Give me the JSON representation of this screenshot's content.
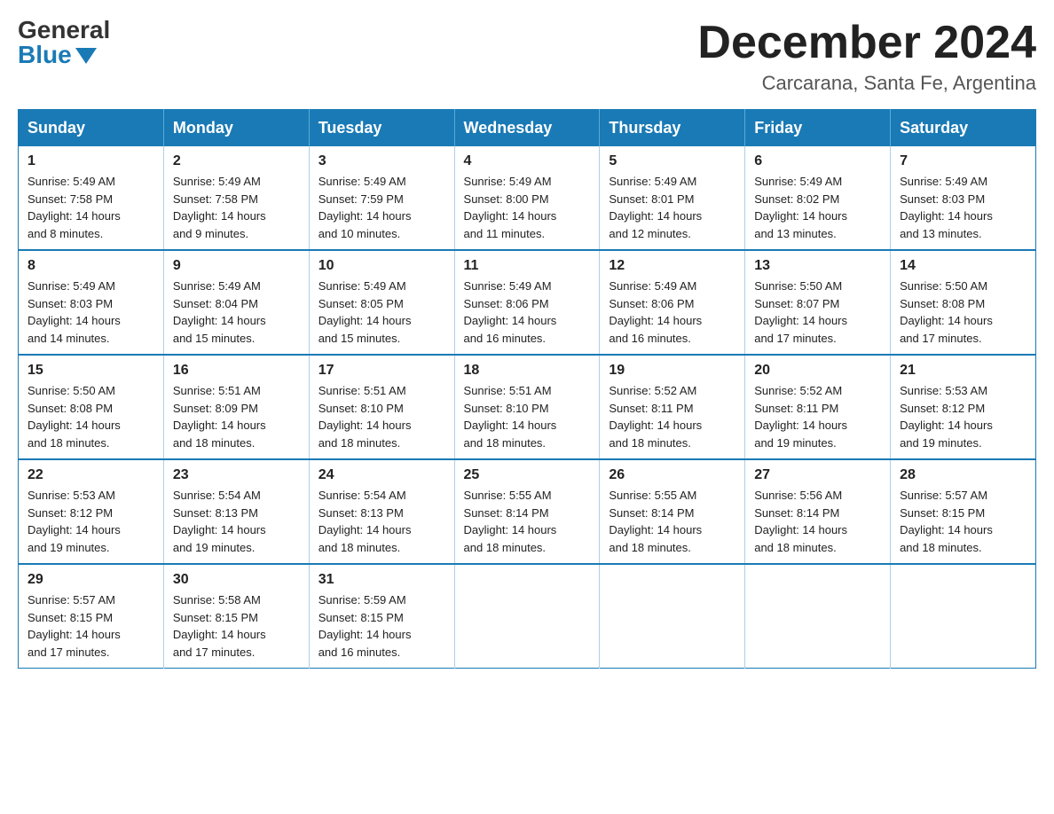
{
  "logo": {
    "general": "General",
    "blue": "Blue"
  },
  "header": {
    "month_year": "December 2024",
    "location": "Carcarana, Santa Fe, Argentina"
  },
  "weekdays": [
    "Sunday",
    "Monday",
    "Tuesday",
    "Wednesday",
    "Thursday",
    "Friday",
    "Saturday"
  ],
  "weeks": [
    [
      {
        "day": "1",
        "sunrise": "5:49 AM",
        "sunset": "7:58 PM",
        "daylight": "14 hours and 8 minutes."
      },
      {
        "day": "2",
        "sunrise": "5:49 AM",
        "sunset": "7:58 PM",
        "daylight": "14 hours and 9 minutes."
      },
      {
        "day": "3",
        "sunrise": "5:49 AM",
        "sunset": "7:59 PM",
        "daylight": "14 hours and 10 minutes."
      },
      {
        "day": "4",
        "sunrise": "5:49 AM",
        "sunset": "8:00 PM",
        "daylight": "14 hours and 11 minutes."
      },
      {
        "day": "5",
        "sunrise": "5:49 AM",
        "sunset": "8:01 PM",
        "daylight": "14 hours and 12 minutes."
      },
      {
        "day": "6",
        "sunrise": "5:49 AM",
        "sunset": "8:02 PM",
        "daylight": "14 hours and 13 minutes."
      },
      {
        "day": "7",
        "sunrise": "5:49 AM",
        "sunset": "8:03 PM",
        "daylight": "14 hours and 13 minutes."
      }
    ],
    [
      {
        "day": "8",
        "sunrise": "5:49 AM",
        "sunset": "8:03 PM",
        "daylight": "14 hours and 14 minutes."
      },
      {
        "day": "9",
        "sunrise": "5:49 AM",
        "sunset": "8:04 PM",
        "daylight": "14 hours and 15 minutes."
      },
      {
        "day": "10",
        "sunrise": "5:49 AM",
        "sunset": "8:05 PM",
        "daylight": "14 hours and 15 minutes."
      },
      {
        "day": "11",
        "sunrise": "5:49 AM",
        "sunset": "8:06 PM",
        "daylight": "14 hours and 16 minutes."
      },
      {
        "day": "12",
        "sunrise": "5:49 AM",
        "sunset": "8:06 PM",
        "daylight": "14 hours and 16 minutes."
      },
      {
        "day": "13",
        "sunrise": "5:50 AM",
        "sunset": "8:07 PM",
        "daylight": "14 hours and 17 minutes."
      },
      {
        "day": "14",
        "sunrise": "5:50 AM",
        "sunset": "8:08 PM",
        "daylight": "14 hours and 17 minutes."
      }
    ],
    [
      {
        "day": "15",
        "sunrise": "5:50 AM",
        "sunset": "8:08 PM",
        "daylight": "14 hours and 18 minutes."
      },
      {
        "day": "16",
        "sunrise": "5:51 AM",
        "sunset": "8:09 PM",
        "daylight": "14 hours and 18 minutes."
      },
      {
        "day": "17",
        "sunrise": "5:51 AM",
        "sunset": "8:10 PM",
        "daylight": "14 hours and 18 minutes."
      },
      {
        "day": "18",
        "sunrise": "5:51 AM",
        "sunset": "8:10 PM",
        "daylight": "14 hours and 18 minutes."
      },
      {
        "day": "19",
        "sunrise": "5:52 AM",
        "sunset": "8:11 PM",
        "daylight": "14 hours and 18 minutes."
      },
      {
        "day": "20",
        "sunrise": "5:52 AM",
        "sunset": "8:11 PM",
        "daylight": "14 hours and 19 minutes."
      },
      {
        "day": "21",
        "sunrise": "5:53 AM",
        "sunset": "8:12 PM",
        "daylight": "14 hours and 19 minutes."
      }
    ],
    [
      {
        "day": "22",
        "sunrise": "5:53 AM",
        "sunset": "8:12 PM",
        "daylight": "14 hours and 19 minutes."
      },
      {
        "day": "23",
        "sunrise": "5:54 AM",
        "sunset": "8:13 PM",
        "daylight": "14 hours and 19 minutes."
      },
      {
        "day": "24",
        "sunrise": "5:54 AM",
        "sunset": "8:13 PM",
        "daylight": "14 hours and 18 minutes."
      },
      {
        "day": "25",
        "sunrise": "5:55 AM",
        "sunset": "8:14 PM",
        "daylight": "14 hours and 18 minutes."
      },
      {
        "day": "26",
        "sunrise": "5:55 AM",
        "sunset": "8:14 PM",
        "daylight": "14 hours and 18 minutes."
      },
      {
        "day": "27",
        "sunrise": "5:56 AM",
        "sunset": "8:14 PM",
        "daylight": "14 hours and 18 minutes."
      },
      {
        "day": "28",
        "sunrise": "5:57 AM",
        "sunset": "8:15 PM",
        "daylight": "14 hours and 18 minutes."
      }
    ],
    [
      {
        "day": "29",
        "sunrise": "5:57 AM",
        "sunset": "8:15 PM",
        "daylight": "14 hours and 17 minutes."
      },
      {
        "day": "30",
        "sunrise": "5:58 AM",
        "sunset": "8:15 PM",
        "daylight": "14 hours and 17 minutes."
      },
      {
        "day": "31",
        "sunrise": "5:59 AM",
        "sunset": "8:15 PM",
        "daylight": "14 hours and 16 minutes."
      },
      null,
      null,
      null,
      null
    ]
  ],
  "labels": {
    "sunrise": "Sunrise:",
    "sunset": "Sunset:",
    "daylight": "Daylight:"
  }
}
